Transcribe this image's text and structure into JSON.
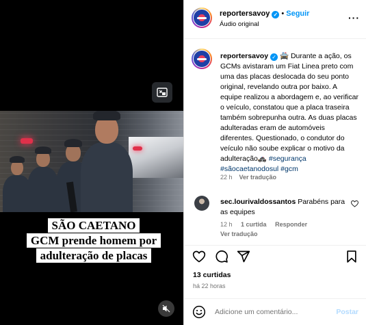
{
  "video": {
    "caption_lines": [
      "SÃO CAETANO",
      "GCM  prende homem por",
      "adulteração de placas"
    ]
  },
  "header": {
    "username": "reportersavoy",
    "separator": "•",
    "follow_label": "Seguir",
    "audio_label": "Áudio original",
    "more": "···"
  },
  "post": {
    "username": "reportersavoy",
    "emoji": "🚔",
    "text": "Durante a ação, os GCMs avistaram um Fiat Linea preto com uma das placas deslocada do seu ponto original, revelando outra por baixo. A equipe realizou a abordagem e, ao verificar o veículo, constatou que a placa traseira também sobrepunha outra. As duas placas adulteradas eram de automóveis diferentes. Questionado, o condutor do veículo não soube explicar o motivo da adulteração",
    "end_emoji": "🚓",
    "hashtags": [
      "#segurança",
      "#sãocaetanodosul",
      "#gcm"
    ],
    "time": "22 h",
    "translate": "Ver tradução"
  },
  "comment": {
    "username": "sec.lourivaldossantos",
    "text": "Parabéns para as equipes",
    "time": "12 h",
    "likes": "1 curtida",
    "reply": "Responder",
    "translate": "Ver tradução"
  },
  "stats": {
    "likes": "13 curtidas",
    "ago": "há 22 horas"
  },
  "add_comment": {
    "placeholder": "Adicione um comentário...",
    "post_label": "Postar"
  },
  "colors": {
    "accent": "#0095f6",
    "muted": "#737373",
    "hashtag": "#00376b",
    "post_disabled": "#b3dbff"
  }
}
